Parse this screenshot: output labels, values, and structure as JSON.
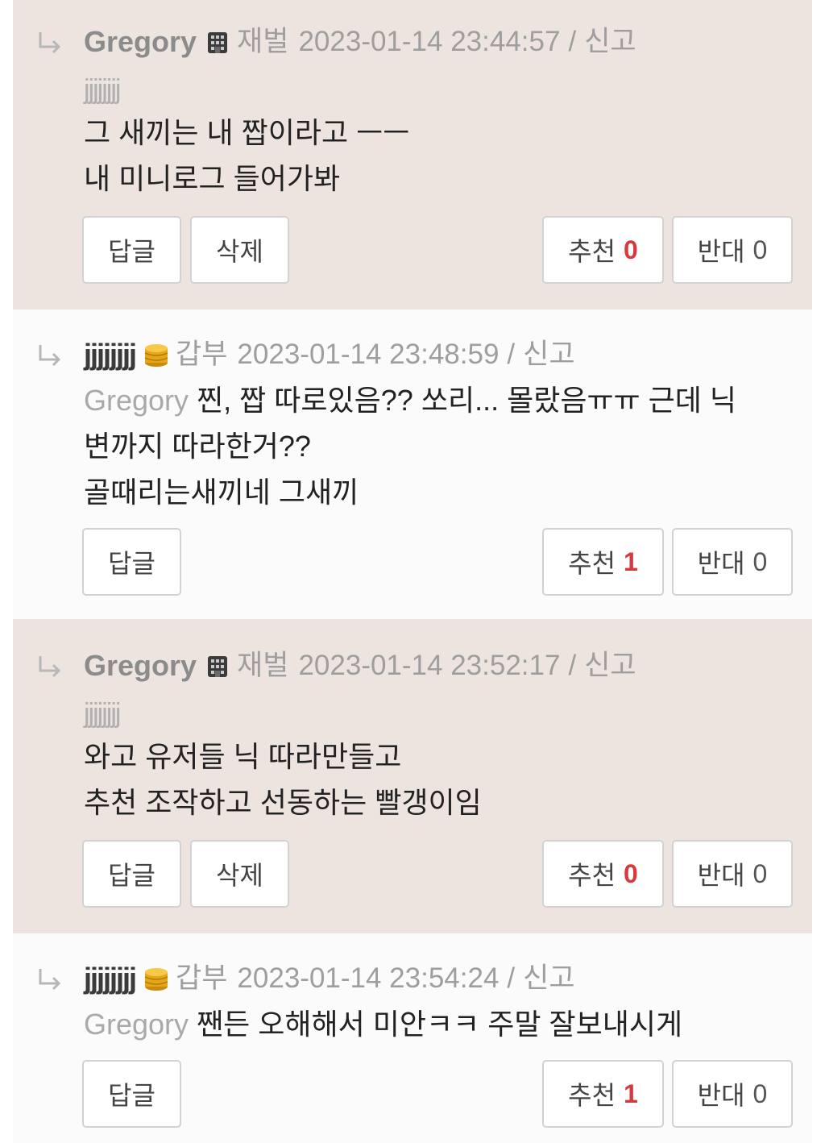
{
  "colors": {
    "tinted_bg": "#ede4df",
    "plain_bg": "#fbfbfb",
    "accent_red": "#d8393d"
  },
  "labels": {
    "reply": "답글",
    "delete": "삭제",
    "recommend": "추천",
    "oppose": "반대"
  },
  "comments": [
    {
      "author": "Gregory",
      "badge_icon": "building-icon",
      "rank": "재벌",
      "timestamp": "2023-01-14 23:44:57",
      "separator": "/",
      "report": "신고",
      "mention": "jjjjjjjj",
      "lines": [
        "그 새끼는 내 짭이라고 ㅡㅡ",
        "내 미니로그 들어가봐"
      ],
      "recommend_count": "0",
      "oppose_count": "0"
    },
    {
      "author": "jjjjjjjj",
      "badge_icon": "coin-icon",
      "rank": "갑부",
      "timestamp": "2023-01-14 23:48:59",
      "separator": "/",
      "report": "신고",
      "mention": "Gregory",
      "lines": [
        "찐, 짭 따로있음?? 쏘리... 몰랐음ㅠㅠ 근데 닉",
        "변까지 따라한거??",
        "골때리는새끼네 그새끼"
      ],
      "recommend_count": "1",
      "oppose_count": "0"
    },
    {
      "author": "Gregory",
      "badge_icon": "building-icon",
      "rank": "재벌",
      "timestamp": "2023-01-14 23:52:17",
      "separator": "/",
      "report": "신고",
      "mention": "jjjjjjjj",
      "lines": [
        "와고 유저들 닉 따라만들고",
        "추천 조작하고 선동하는 빨갱이임"
      ],
      "recommend_count": "0",
      "oppose_count": "0"
    },
    {
      "author": "jjjjjjjj",
      "badge_icon": "coin-icon",
      "rank": "갑부",
      "timestamp": "2023-01-14 23:54:24",
      "separator": "/",
      "report": "신고",
      "mention": "Gregory",
      "lines": [
        "짼든 오해해서 미안ㅋㅋ 주말 잘보내시게"
      ],
      "recommend_count": "1",
      "oppose_count": "0"
    }
  ]
}
